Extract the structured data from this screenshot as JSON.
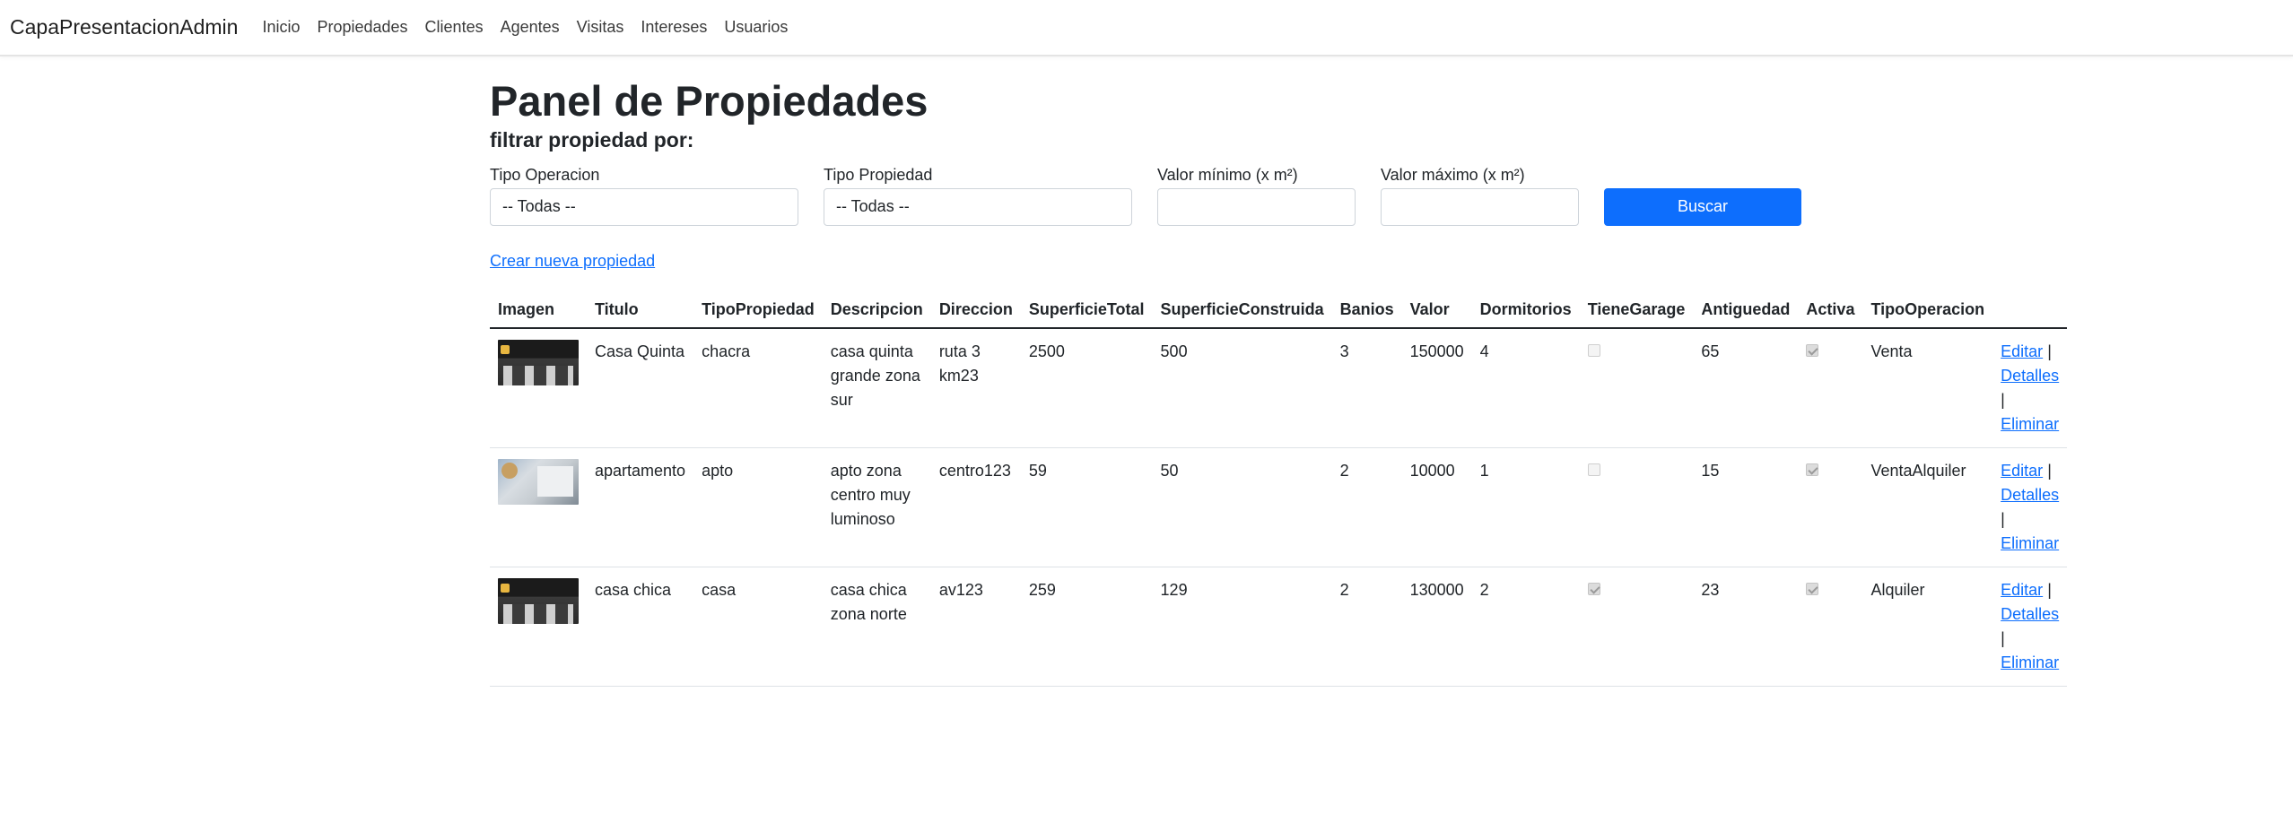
{
  "navbar": {
    "brand": "CapaPresentacionAdmin",
    "items": [
      "Inicio",
      "Propiedades",
      "Clientes",
      "Agentes",
      "Visitas",
      "Intereses",
      "Usuarios"
    ]
  },
  "page": {
    "title": "Panel de Propiedades",
    "subtitle": "filtrar propiedad por:"
  },
  "filters": {
    "tipo_operacion_label": "Tipo Operacion",
    "tipo_operacion_value": "-- Todas --",
    "tipo_propiedad_label": "Tipo Propiedad",
    "tipo_propiedad_value": "-- Todas --",
    "valor_min_label": "Valor mínimo (x m²)",
    "valor_min_value": "",
    "valor_max_label": "Valor máximo (x m²)",
    "valor_max_value": "",
    "search_button": "Buscar"
  },
  "create_link": "Crear nueva propiedad",
  "table": {
    "headers": [
      "Imagen",
      "Titulo",
      "TipoPropiedad",
      "Descripcion",
      "Direccion",
      "SuperficieTotal",
      "SuperficieConstruida",
      "Banios",
      "Valor",
      "Dormitorios",
      "TieneGarage",
      "Antiguedad",
      "Activa",
      "TipoOperacion"
    ],
    "rows": [
      {
        "image": "casa-interior-thumbnail",
        "titulo": "Casa Quinta",
        "tipo": "chacra",
        "descripcion": "casa quinta grande zona sur",
        "direccion": "ruta 3 km23",
        "sup_total": "2500",
        "sup_construida": "500",
        "banios": "3",
        "valor": "150000",
        "dormitorios": "4",
        "garage": false,
        "antiguedad": "65",
        "activa": true,
        "operacion": "Venta"
      },
      {
        "image": "apartamento-thumbnail",
        "titulo": "apartamento",
        "tipo": "apto",
        "descripcion": "apto zona centro muy luminoso",
        "direccion": "centro123",
        "sup_total": "59",
        "sup_construida": "50",
        "banios": "2",
        "valor": "10000",
        "dormitorios": "1",
        "garage": false,
        "antiguedad": "15",
        "activa": true,
        "operacion": "VentaAlquiler"
      },
      {
        "image": "casa-interior-thumbnail",
        "titulo": "casa chica",
        "tipo": "casa",
        "descripcion": "casa chica zona norte",
        "direccion": "av123",
        "sup_total": "259",
        "sup_construida": "129",
        "banios": "2",
        "valor": "130000",
        "dormitorios": "2",
        "garage": true,
        "antiguedad": "23",
        "activa": true,
        "operacion": "Alquiler"
      }
    ],
    "actions": {
      "edit": "Editar",
      "details": "Detalles",
      "delete": "Eliminar",
      "separator": "|"
    }
  }
}
